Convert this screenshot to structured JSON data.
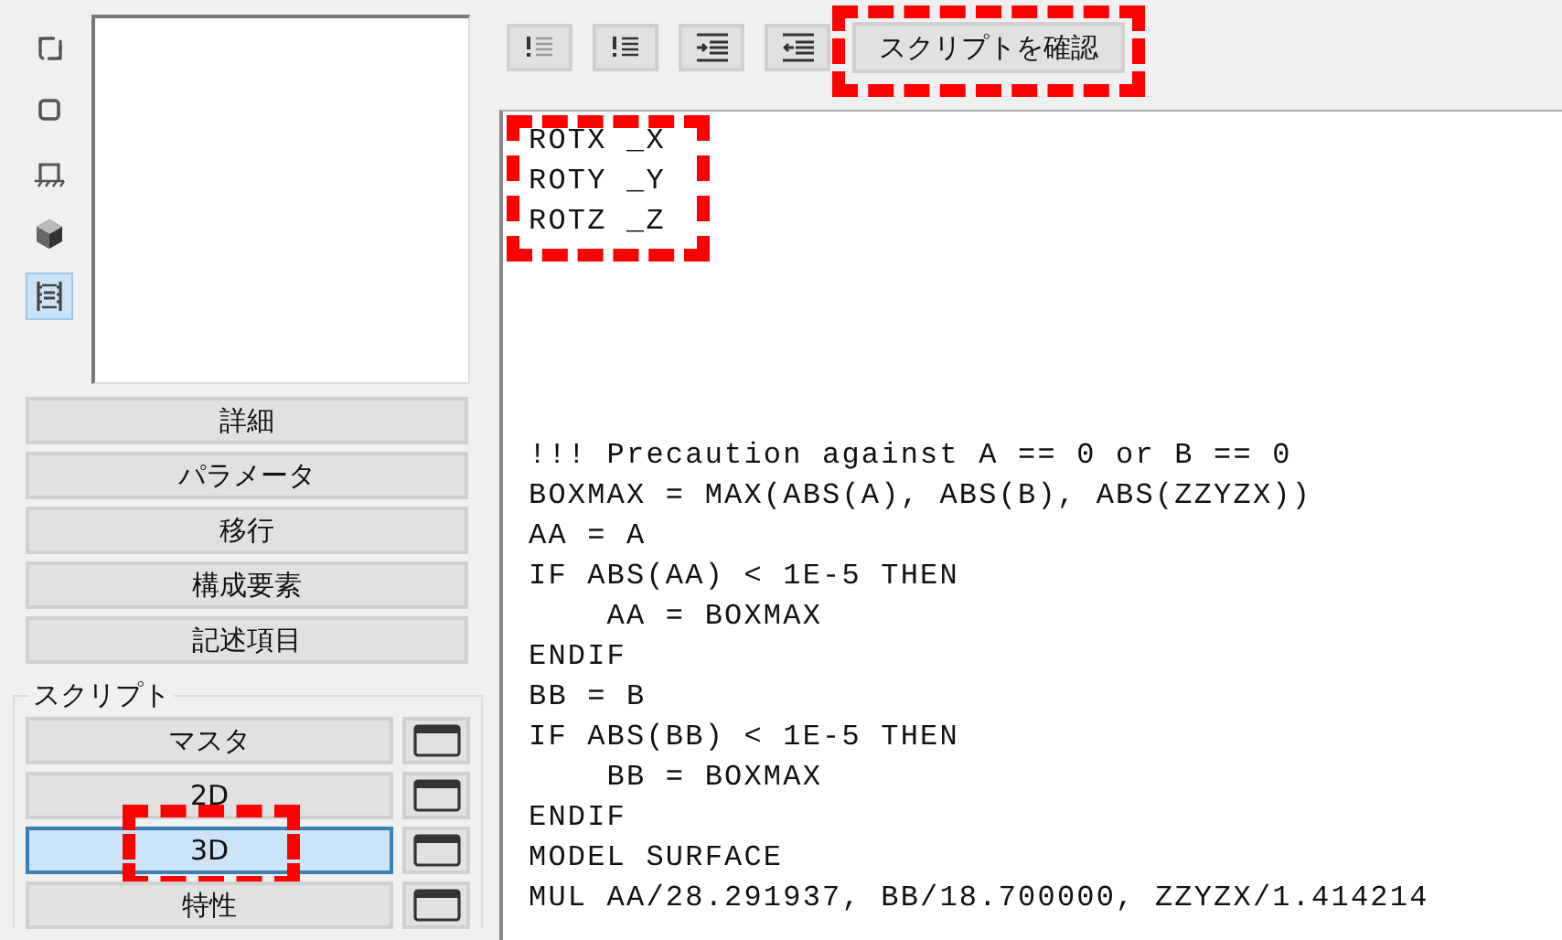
{
  "view_icons": [
    {
      "kind": "frame",
      "selected": false
    },
    {
      "kind": "square",
      "selected": false
    },
    {
      "kind": "bench",
      "selected": false
    },
    {
      "kind": "cube",
      "selected": false
    },
    {
      "kind": "film",
      "selected": true
    }
  ],
  "section_buttons": [
    "詳細",
    "パラメータ",
    "移行",
    "構成要素",
    "記述項目"
  ],
  "script_group": {
    "title": "スクリプト",
    "items": [
      {
        "label": "マスタ",
        "selected": false,
        "highlighted": false
      },
      {
        "label": "2D",
        "selected": false,
        "highlighted": false
      },
      {
        "label": "3D",
        "selected": true,
        "highlighted": true
      },
      {
        "label": "特性",
        "selected": false,
        "highlighted": false
      }
    ]
  },
  "toolbar": {
    "icon_buttons": [
      {
        "kind": "comment"
      },
      {
        "kind": "uncomment"
      },
      {
        "kind": "indent"
      },
      {
        "kind": "outdent"
      }
    ],
    "check_button": {
      "label": "スクリプトを確認",
      "highlighted": true
    }
  },
  "code_blocks": [
    {
      "highlighted": true,
      "lines": [
        "ROTX _X",
        "ROTY _Y",
        "ROTZ _Z"
      ]
    },
    {
      "lines": [
        "!!! Precaution against A == 0 or B == 0",
        "BOXMAX = MAX(ABS(A), ABS(B), ABS(ZZYZX))",
        "AA = A",
        "IF ABS(AA) < 1E-5 THEN",
        "    AA = BOXMAX",
        "ENDIF",
        "BB = B",
        "IF ABS(BB) < 1E-5 THEN",
        "    BB = BOXMAX",
        "ENDIF",
        "MODEL SURFACE",
        "MUL AA/28.291937, BB/18.700000, ZZYZX/1.414214"
      ]
    }
  ]
}
